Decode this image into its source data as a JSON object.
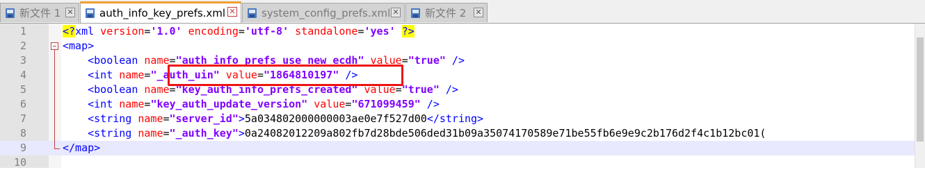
{
  "tabs": [
    {
      "label": "新文件 1",
      "active": false
    },
    {
      "label": "auth_info_key_prefs.xml",
      "active": true
    },
    {
      "label": "system_config_prefs.xml",
      "active": false
    },
    {
      "label": "新文件 2",
      "active": false
    }
  ],
  "close_glyph": "✕",
  "editor": {
    "line_numbers": [
      "1",
      "2",
      "3",
      "4",
      "5",
      "6",
      "7",
      "8",
      "9",
      "10"
    ],
    "line1": {
      "pi_open": "<?",
      "pi_name": "xml",
      "attr1": " version",
      "eq1": "=",
      "val1": "'1.0'",
      "attr2": " encoding",
      "eq2": "=",
      "val2": "'utf-8'",
      "attr3": " standalone",
      "eq3": "=",
      "val3": "'yes'",
      "pi_close": "?>"
    },
    "line2": {
      "open": "<map>"
    },
    "line3": {
      "tag": "<boolean",
      "attr": " name",
      "eq": "=",
      "val": "\"auth_info_prefs_use_new_ecdh\"",
      "attr2": " value",
      "eq2": "=",
      "val2": "\"true\"",
      "close": " />"
    },
    "line4": {
      "tag": "<int",
      "attr": " name",
      "eq": "=",
      "val": "\"_auth_uin\"",
      "attr2": " value",
      "eq2": "=",
      "val2": "\"1864810197\"",
      "close": " />"
    },
    "line5": {
      "tag": "<boolean",
      "attr": " name",
      "eq": "=",
      "val": "\"key_auth_info_prefs_created\"",
      "attr2": " value",
      "eq2": "=",
      "val2": "\"true\"",
      "close": " />"
    },
    "line6": {
      "tag": "<int",
      "attr": " name",
      "eq": "=",
      "val": "\"key_auth_update_version\"",
      "attr2": " value",
      "eq2": "=",
      "val2": "\"671099459\"",
      "close": " />"
    },
    "line7": {
      "tag": "<string",
      "attr": " name",
      "eq": "=",
      "val": "\"server_id\"",
      "gt": ">",
      "text": "5a034802000000003ae0e7f527d00",
      "end": "</string>"
    },
    "line8": {
      "tag": "<string",
      "attr": " name",
      "eq": "=",
      "val": "\"_auth_key\"",
      "gt": ">",
      "text": "0a24082012209a802fb7d28bde506ded31b09a35074170589e71be55fb6e9e9c2b176d2f4c1b12bc01("
    },
    "line9": {
      "close": "</map>"
    },
    "indent": "    "
  }
}
